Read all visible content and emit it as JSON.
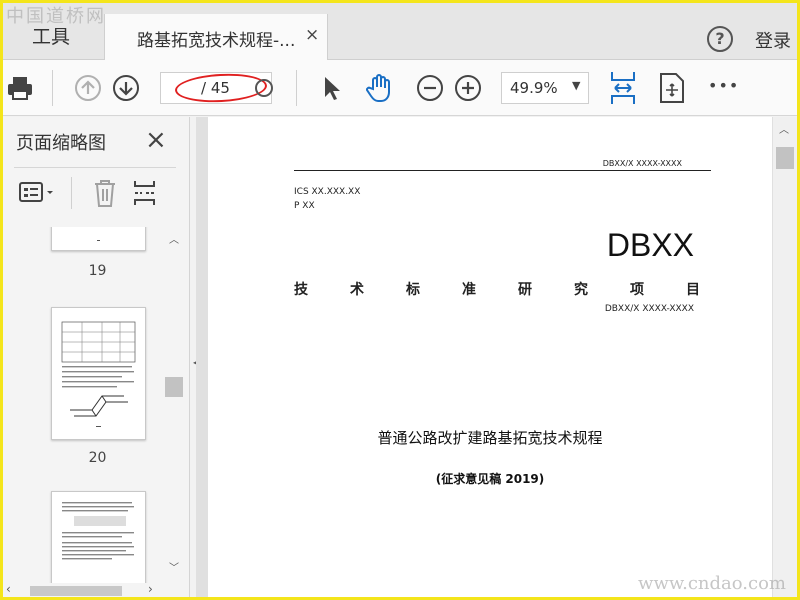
{
  "watermark": {
    "top": "中国道桥网",
    "bottom": "www.cndao.com"
  },
  "tabs": {
    "tools": "工具",
    "document": "路基拓宽技术规程-...",
    "close": "×"
  },
  "header": {
    "help": "?",
    "login": "登录"
  },
  "toolbar": {
    "page_total": "/ 45",
    "zoom": "49.9%",
    "zoom_caret": "▼",
    "more": "•••"
  },
  "panel": {
    "title": "页面缩略图",
    "close": "×",
    "thumbnails": [
      {
        "page": "19"
      },
      {
        "page": "20"
      }
    ]
  },
  "document": {
    "std_number": "DBXX/X XXXX-XXXX",
    "ics": "ICS XX.XXX.XX",
    "p": "P XX",
    "big_code": "DBXX",
    "project_chars": [
      "技",
      "术",
      "标",
      "准",
      "研",
      "究",
      "项",
      "目"
    ],
    "code_line": "DBXX/X XXXX-XXXX",
    "title": "普通公路改扩建路基拓宽技术规程",
    "subtitle": "(征求意见稿 2019)"
  },
  "colors": {
    "frame": "#f4e51b",
    "annotation": "#e02020"
  }
}
